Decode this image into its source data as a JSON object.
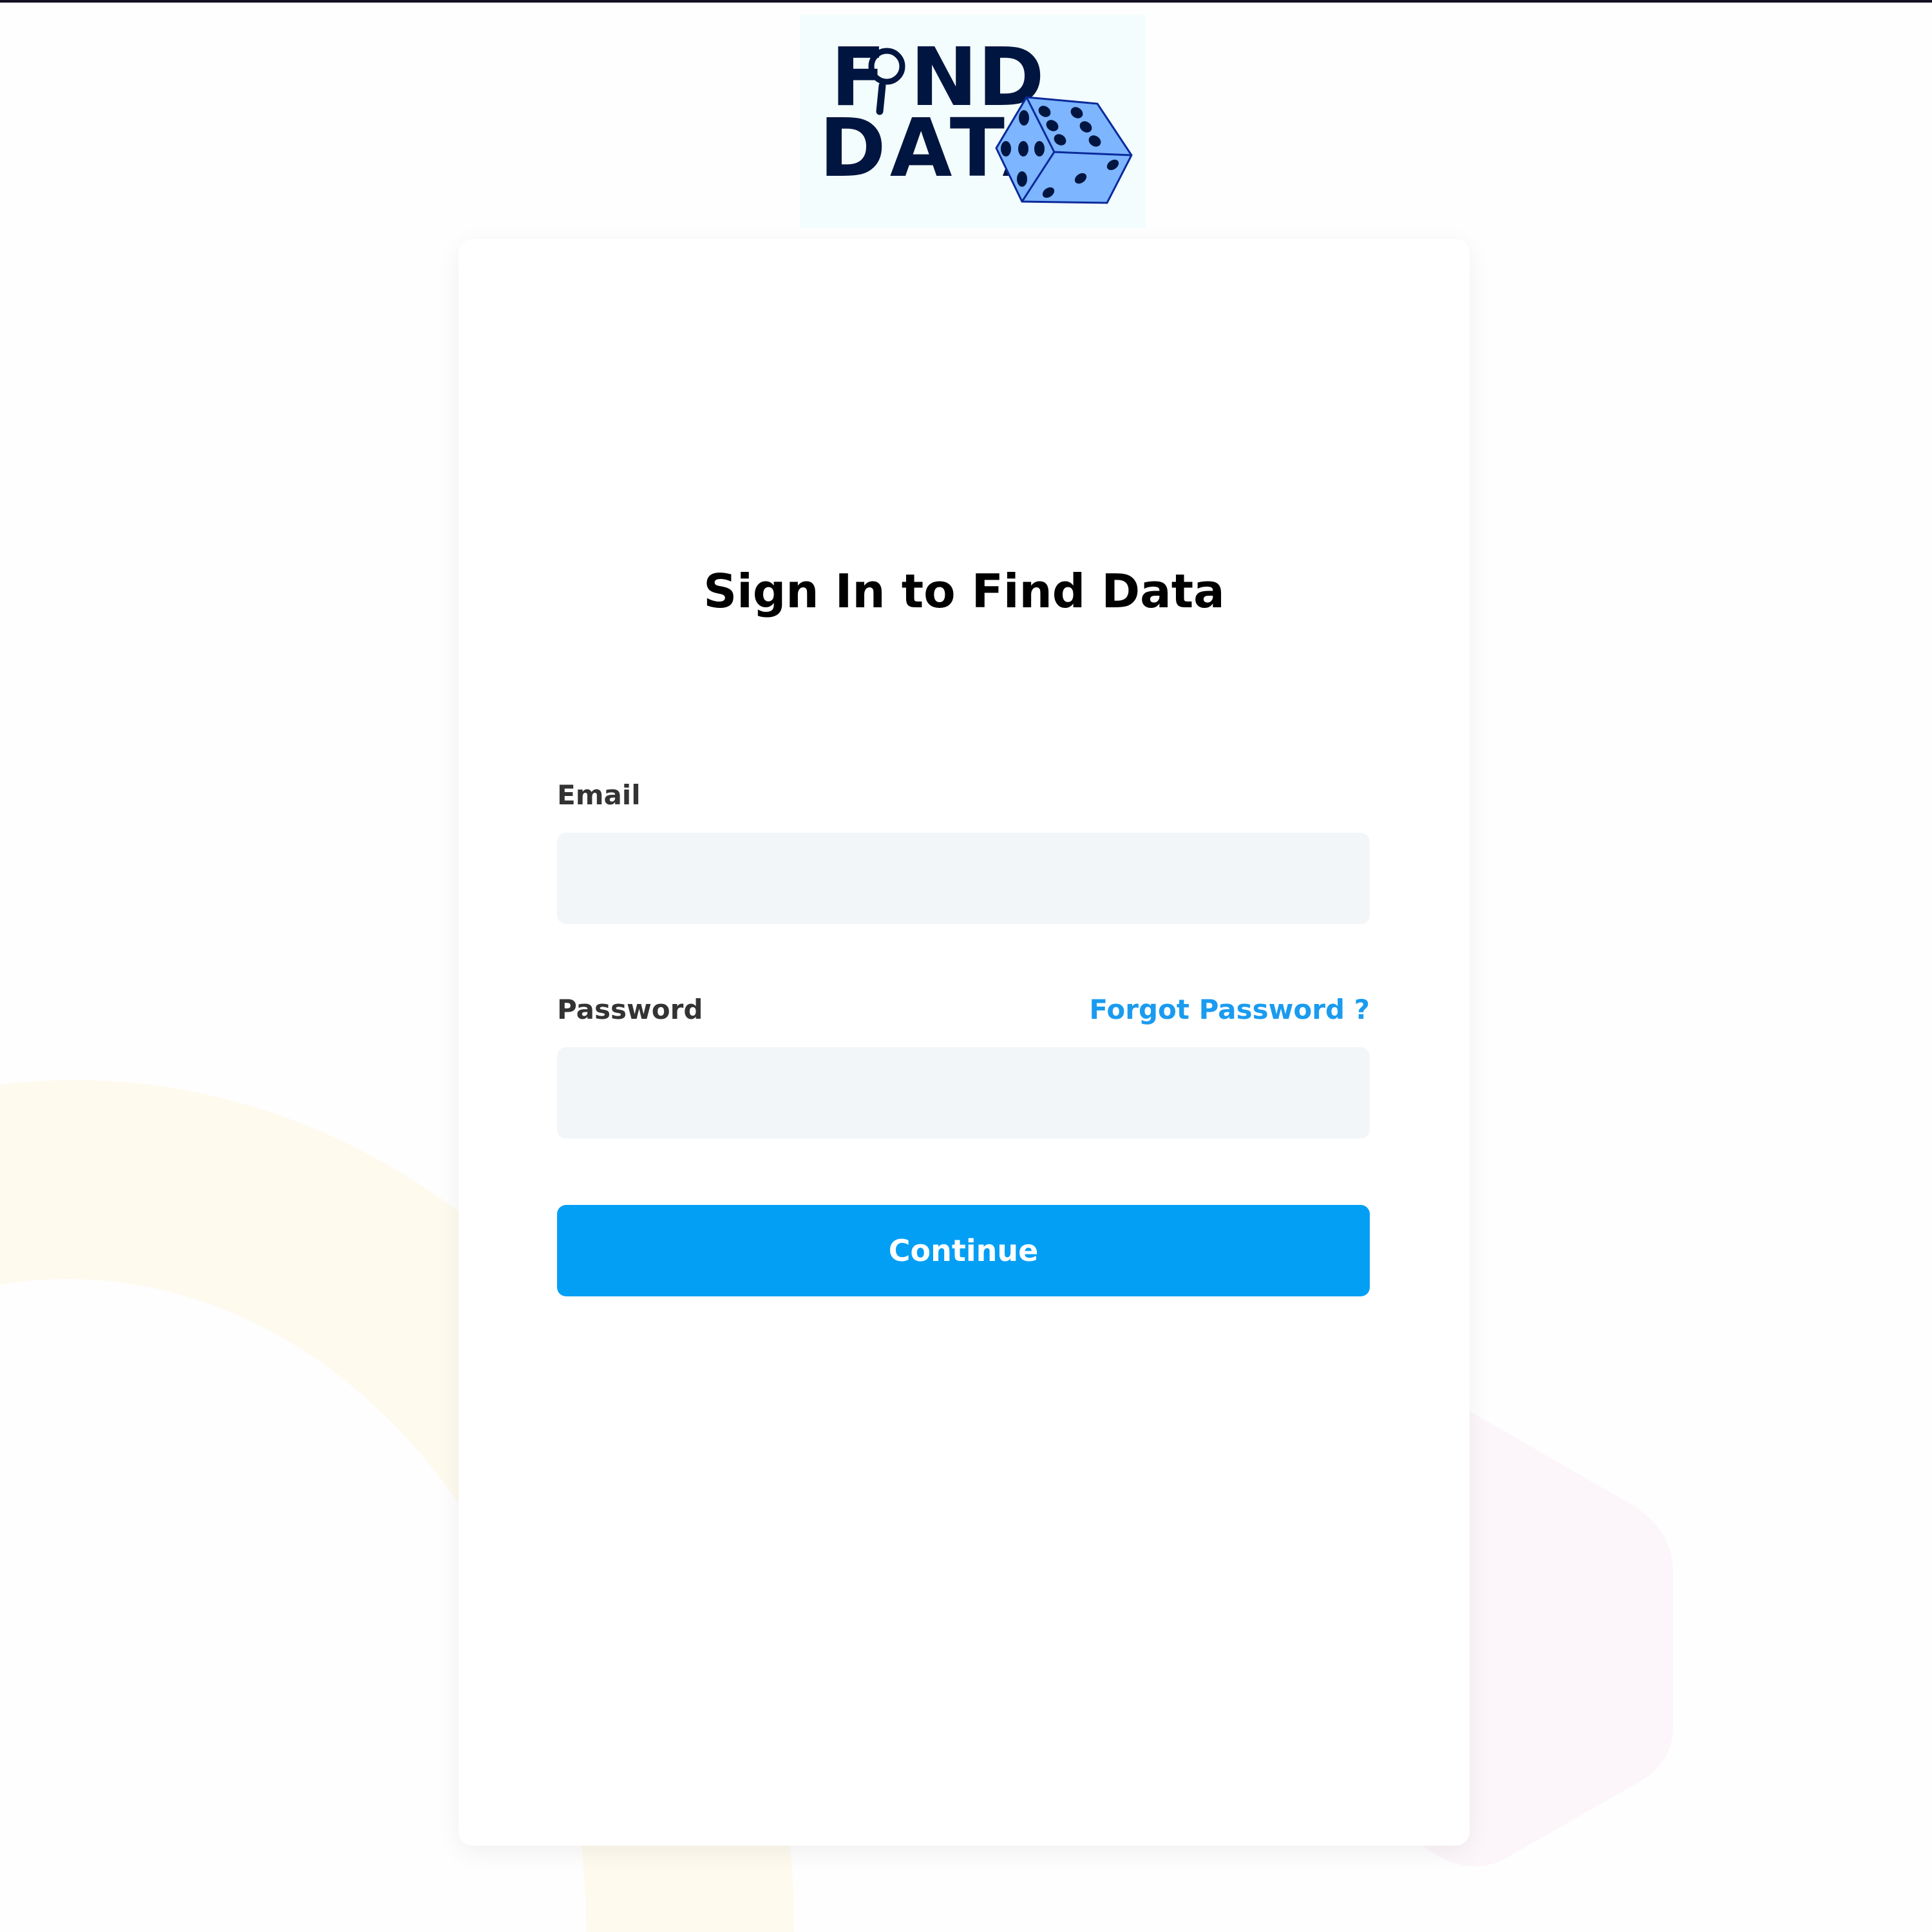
{
  "logo": {
    "text_line1": "FIND",
    "text_line2": "DATA"
  },
  "signin": {
    "title": "Sign In to Find Data",
    "email_label": "Email",
    "email_value": "",
    "password_label": "Password",
    "password_value": "",
    "forgot_password": "Forgot Password ?",
    "continue_label": "Continue"
  },
  "colors": {
    "accent": "#039ff5",
    "link": "#1a9bf0",
    "logo_navy": "#001540",
    "dice_blue": "#7db5ff"
  }
}
